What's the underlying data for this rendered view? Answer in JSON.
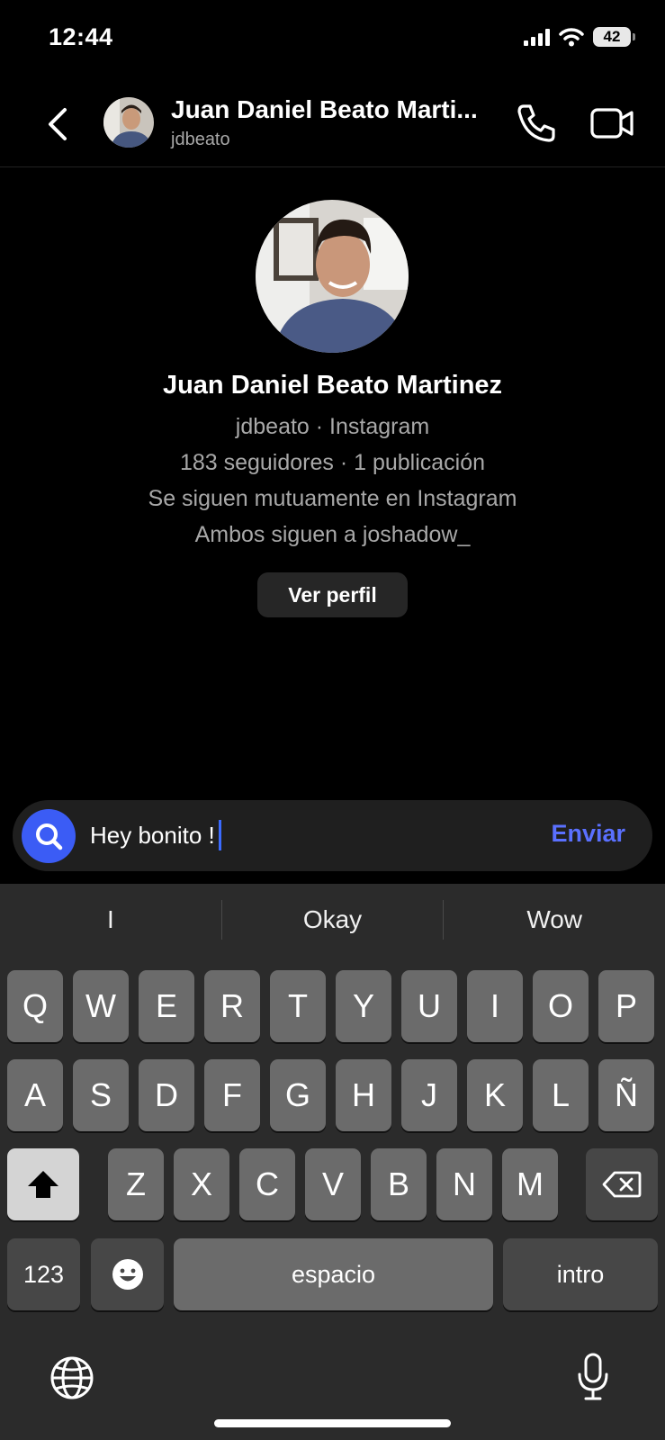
{
  "status": {
    "time": "12:44",
    "battery": "42"
  },
  "header": {
    "name": "Juan Daniel Beato Marti...",
    "username": "jdbeato"
  },
  "profile": {
    "name": "Juan Daniel Beato Martinez",
    "subtitle": "jdbeato · Instagram",
    "stats": "183 seguidores · 1 publicación",
    "mutual": "Se siguen mutuamente en Instagram",
    "follows": "Ambos siguen a joshadow_",
    "view_profile": "Ver perfil"
  },
  "composer": {
    "text": "Hey bonito !",
    "send_label": "Enviar"
  },
  "keyboard": {
    "suggestions": [
      "I",
      "Okay",
      "Wow"
    ],
    "row1": [
      "Q",
      "W",
      "E",
      "R",
      "T",
      "Y",
      "U",
      "I",
      "O",
      "P"
    ],
    "row2": [
      "A",
      "S",
      "D",
      "F",
      "G",
      "H",
      "J",
      "K",
      "L",
      "Ñ"
    ],
    "row3": [
      "Z",
      "X",
      "C",
      "V",
      "B",
      "N",
      "M"
    ],
    "numbers_label": "123",
    "space_label": "espacio",
    "return_label": "intro"
  },
  "colors": {
    "accent": "#3b5cf5",
    "send": "#5a70ff",
    "background": "#000000"
  }
}
